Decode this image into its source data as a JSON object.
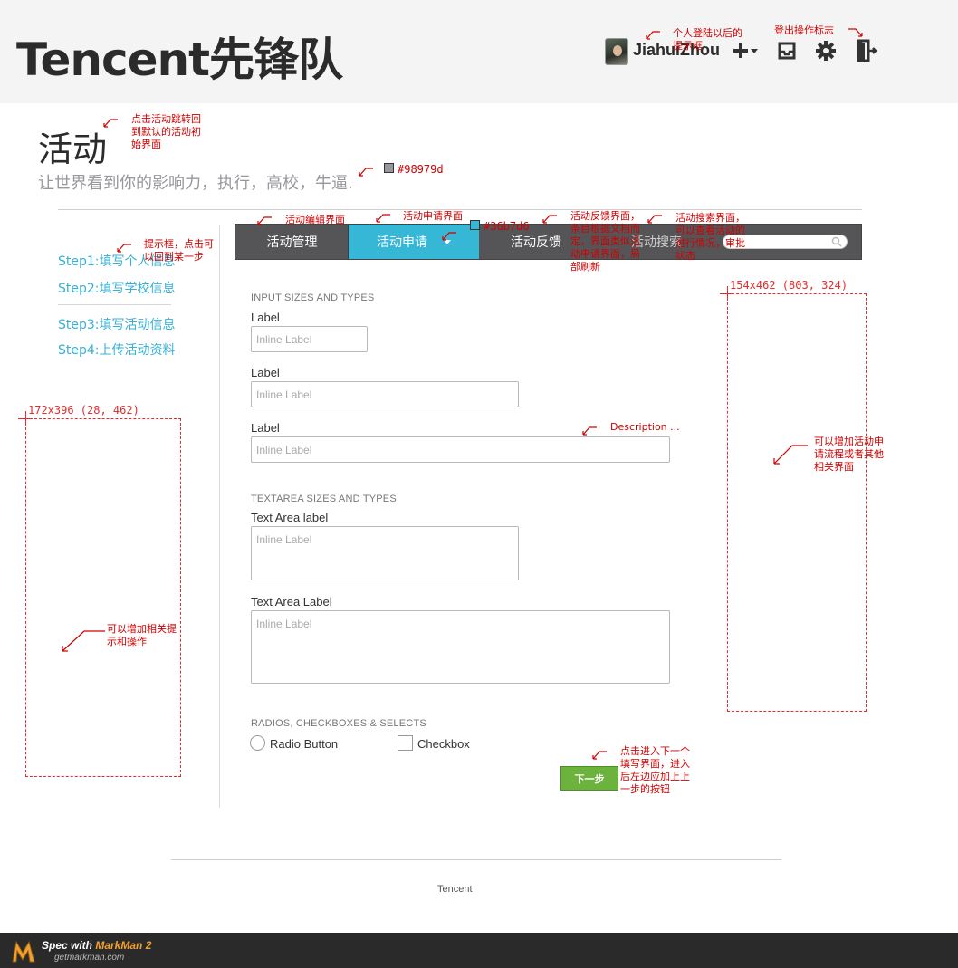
{
  "header": {
    "brand": "Tencent先锋队",
    "username": "JiahuiZhou"
  },
  "page": {
    "title": "活动",
    "subtitle": "让世界看到你的影响力，执行，高校，牛逼."
  },
  "sidebar": {
    "steps": [
      {
        "label": "Step1:填写个人信息"
      },
      {
        "label": "Step2:填写学校信息"
      },
      {
        "label": "Step3:填写活动信息"
      },
      {
        "label": "Step4:上传活动资料"
      }
    ]
  },
  "nav": {
    "items": [
      {
        "label": "活动管理"
      },
      {
        "label": "活动申请"
      },
      {
        "label": "活动反馈"
      },
      {
        "label": "活动搜索"
      }
    ],
    "active_index": 1,
    "active_color": "#36b7d6"
  },
  "form": {
    "input_section_title": "INPUT SIZES AND TYPES",
    "inputs": [
      {
        "label": "Label",
        "placeholder": "Inline Label"
      },
      {
        "label": "Label",
        "placeholder": "Inline Label"
      },
      {
        "label": "Label",
        "placeholder": "Inline Label"
      }
    ],
    "textarea_section_title": "TEXTAREA SIZES AND TYPES",
    "textareas": [
      {
        "label": "Text Area label",
        "placeholder": "Inline Label"
      },
      {
        "label": "Text Area Label",
        "placeholder": "Inline Label"
      }
    ],
    "options_section_title": "RADIOS, CHECKBOXES & SELECTS",
    "radio_label": "Radio Button",
    "checkbox_label": "Checkbox",
    "next_button": "下一步",
    "next_button_color": "#6cb33e"
  },
  "footer": {
    "text": "Tencent"
  },
  "annotations": {
    "subtitle_color_hex": "#98979d",
    "subtitle_color_label": "#98979d",
    "nav_color_label": "#36b7d6",
    "left_box_dim": "172x396 (28, 462)",
    "right_box_dim": "154x462 (803, 324)",
    "notes": {
      "profile": "个人登陆以后的\n提示框",
      "logout": "登出操作标志",
      "title": "点击活动跳转回\n到默认的活动初\n始界面",
      "steps": "提示框，点击可\n以回到某一步",
      "nav_edit": "活动编辑界面",
      "nav_apply": "活动申请界面",
      "nav_feedback": "活动反馈界面，\n条目根据文档而\n定，界面类似活\n动申请界面，局\n部刷新",
      "nav_search": "活动搜索界面，\n可以查看活动的\n进行情况，审批\n状态",
      "description": "Description ...",
      "right_box": "可以增加活动申\n请流程或者其他\n相关界面",
      "left_box": "可以增加相关提\n示和操作",
      "next": "点击进入下一个\n填写界面，进入\n后左边应加上上\n一步的按钮"
    }
  },
  "markman": {
    "title_prefix": "Spec with ",
    "title_brand": "MarkMan 2",
    "subtitle": "getmarkman.com"
  }
}
